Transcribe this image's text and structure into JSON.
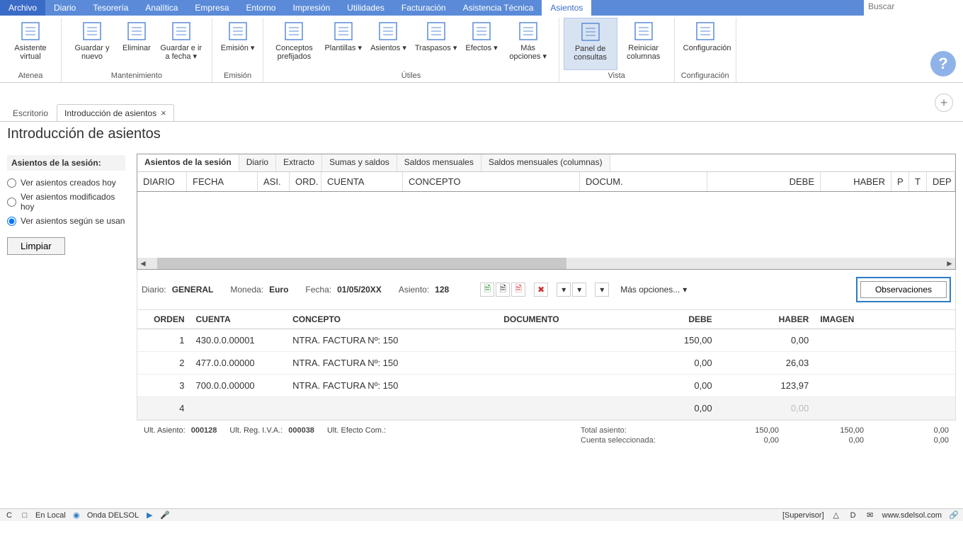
{
  "menu": {
    "items": [
      "Archivo",
      "Diario",
      "Tesorería",
      "Analítica",
      "Empresa",
      "Entorno",
      "Impresión",
      "Utilidades",
      "Facturación",
      "Asistencia Técnica",
      "Asientos"
    ],
    "active": "Asientos",
    "search_placeholder": "Buscar"
  },
  "ribbon": {
    "groups": [
      {
        "label": "Atenea",
        "buttons": [
          {
            "name": "asistente-virtual",
            "label": "Asistente virtual"
          }
        ]
      },
      {
        "label": "Mantenimiento",
        "buttons": [
          {
            "name": "guardar-nuevo",
            "label": "Guardar y nuevo"
          },
          {
            "name": "eliminar",
            "label": "Eliminar"
          },
          {
            "name": "guardar-ir-fecha",
            "label": "Guardar e ir a fecha",
            "dropdown": true
          }
        ]
      },
      {
        "label": "Emisión",
        "buttons": [
          {
            "name": "emision",
            "label": "Emisión",
            "dropdown": true
          }
        ]
      },
      {
        "label": "Útiles",
        "buttons": [
          {
            "name": "conceptos-prefijados",
            "label": "Conceptos prefijados"
          },
          {
            "name": "plantillas",
            "label": "Plantillas",
            "dropdown": true
          },
          {
            "name": "asientos",
            "label": "Asientos",
            "dropdown": true
          },
          {
            "name": "traspasos",
            "label": "Traspasos",
            "dropdown": true
          },
          {
            "name": "efectos",
            "label": "Efectos",
            "dropdown": true
          },
          {
            "name": "mas-opciones",
            "label": "Más opciones",
            "dropdown": true
          }
        ]
      },
      {
        "label": "Vista",
        "buttons": [
          {
            "name": "panel-consultas",
            "label": "Panel de consultas",
            "active": true
          },
          {
            "name": "reiniciar-columnas",
            "label": "Reiniciar columnas"
          }
        ]
      },
      {
        "label": "Configuración",
        "buttons": [
          {
            "name": "configuracion",
            "label": "Configuración"
          }
        ]
      }
    ]
  },
  "doc_tabs": {
    "inactive": "Escritorio",
    "active": "Introducción de asientos"
  },
  "page_title": "Introducción de asientos",
  "sidebar": {
    "title": "Asientos de la sesión:",
    "radios": [
      {
        "label": "Ver asientos creados hoy",
        "checked": false
      },
      {
        "label": "Ver asientos modificados hoy",
        "checked": false
      },
      {
        "label": "Ver asientos según se usan",
        "checked": true
      }
    ],
    "clear": "Limpiar"
  },
  "inner_tabs": [
    "Asientos de la sesión",
    "Diario",
    "Extracto",
    "Sumas y saldos",
    "Saldos mensuales",
    "Saldos mensuales (columnas)"
  ],
  "grid_cols": [
    "DIARIO",
    "FECHA",
    "ASI.",
    "ORD.",
    "CUENTA",
    "CONCEPTO",
    "DOCUM.",
    "DEBE",
    "HABER",
    "P",
    "T",
    "DEP"
  ],
  "info": {
    "diario_k": "Diario:",
    "diario_v": "GENERAL",
    "moneda_k": "Moneda:",
    "moneda_v": "Euro",
    "fecha_k": "Fecha:",
    "fecha_v": "01/05/20XX",
    "asiento_k": "Asiento:",
    "asiento_v": "128",
    "more": "Más opciones...",
    "observ": "Observaciones"
  },
  "entries": {
    "cols": [
      "ORDEN",
      "CUENTA",
      "CONCEPTO",
      "DOCUMENTO",
      "DEBE",
      "HABER",
      "IMAGEN"
    ],
    "rows": [
      {
        "orden": "1",
        "cuenta": "430.0.0.00001",
        "concepto": "NTRA. FACTURA Nº:  150",
        "documento": "",
        "debe": "150,00",
        "haber": "0,00"
      },
      {
        "orden": "2",
        "cuenta": "477.0.0.00000",
        "concepto": "NTRA. FACTURA Nº:  150",
        "documento": "",
        "debe": "0,00",
        "haber": "26,03"
      },
      {
        "orden": "3",
        "cuenta": "700.0.0.00000",
        "concepto": "NTRA. FACTURA Nº:  150",
        "documento": "",
        "debe": "0,00",
        "haber": "123,97"
      },
      {
        "orden": "4",
        "cuenta": "",
        "concepto": "",
        "documento": "",
        "debe": "0,00",
        "haber": "0,00",
        "edit": true
      }
    ]
  },
  "totals": {
    "ult_asiento_k": "Ult. Asiento:",
    "ult_asiento_v": "000128",
    "ult_reg_iva_k": "Ult. Reg. I.V.A.:",
    "ult_reg_iva_v": "000038",
    "ult_efecto_k": "Ult. Efecto Com.:",
    "ult_efecto_v": "",
    "total_asiento_k": "Total asiento:",
    "cuenta_sel_k": "Cuenta seleccionada:",
    "row1": [
      "150,00",
      "150,00",
      "0,00"
    ],
    "row2": [
      "0,00",
      "0,00",
      "0,00"
    ]
  },
  "status": {
    "local": "En Local",
    "onda": "Onda DELSOL",
    "supervisor": "[Supervisor]",
    "url": "www.sdelsol.com"
  }
}
